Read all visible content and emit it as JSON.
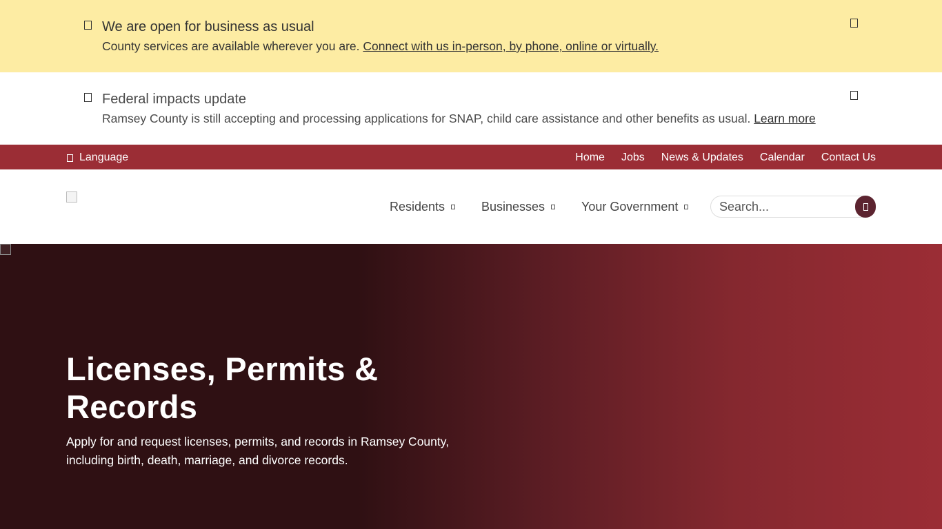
{
  "alerts": [
    {
      "title": "We are open for business as usual",
      "message": "County services are available wherever you are. ",
      "link": "Connect with us in-person, by phone, online or virtually."
    },
    {
      "title": "Federal impacts update",
      "message": "Ramsey County is still accepting and processing applications for SNAP, child care assistance and other benefits as usual. ",
      "link": "Learn more"
    }
  ],
  "utility": {
    "language": "Language",
    "links": [
      "Home",
      "Jobs",
      "News & Updates",
      "Calendar",
      "Contact Us"
    ]
  },
  "nav": {
    "items": [
      "Residents",
      "Businesses",
      "Your Government"
    ]
  },
  "search": {
    "placeholder": "Search..."
  },
  "hero": {
    "title": "Licenses, Permits & Records",
    "subtitle": "Apply for and request licenses, permits, and records in Ramsey County, including birth, death, marriage, and divorce records."
  },
  "colors": {
    "alert_yellow": "#fdeca3",
    "brand_red": "#9b2d35",
    "dark_maroon": "#2f1013",
    "search_button": "#5c2430"
  },
  "icons": {
    "alert": "info-icon",
    "close": "close-icon",
    "language": "globe-icon",
    "caret": "chevron-down-icon",
    "search": "search-icon"
  }
}
